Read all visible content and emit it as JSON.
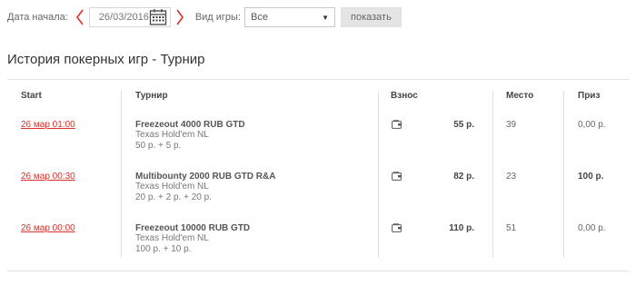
{
  "filters": {
    "date_label": "Дата начала:",
    "date_value": "26/03/2016",
    "game_type_label": "Вид игры:",
    "game_type_value": "Все",
    "show_button": "показать"
  },
  "page_title": "История покерных игр - Турнир",
  "table": {
    "headers": {
      "start": "Start",
      "tournament": "Турнир",
      "fee": "Взнос",
      "place": "Место",
      "prize": "Приз"
    },
    "rows": [
      {
        "start": "26 мар 01:00",
        "name": "Freezeout 4000 RUB GTD",
        "game": "Texas Hold'em NL",
        "buyin": "50 р. + 5 р.",
        "fee": "55 р.",
        "place": "39",
        "prize": "0,00 р.",
        "prize_bold": false
      },
      {
        "start": "26 мар 00:30",
        "name": "Multibounty 2000 RUB GTD R&A",
        "game": "Texas Hold'em NL",
        "buyin": "20 р. + 2 р. + 20 р.",
        "fee": "82 р.",
        "place": "23",
        "prize": "100 р.",
        "prize_bold": true
      },
      {
        "start": "26 мар 00:00",
        "name": "Freezeout 10000 RUB GTD",
        "game": "Texas Hold'em NL",
        "buyin": "100 р. + 10 р.",
        "fee": "110 р.",
        "place": "51",
        "prize": "0,00 р.",
        "prize_bold": false
      }
    ]
  },
  "icons": {
    "prev": "chevron-left-icon",
    "next": "chevron-right-icon",
    "calendar": "calendar-icon",
    "wallet": "wallet-icon",
    "dropdown": "caret-down-icon"
  },
  "colors": {
    "accent": "#d9312b",
    "button_bg": "#e4e4e4"
  }
}
